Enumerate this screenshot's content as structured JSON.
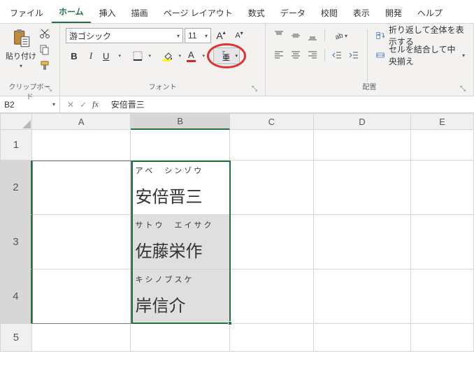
{
  "tabs": [
    "ファイル",
    "ホーム",
    "挿入",
    "描画",
    "ページ レイアウト",
    "数式",
    "データ",
    "校閲",
    "表示",
    "開発",
    "ヘルプ"
  ],
  "active_tab": "ホーム",
  "clipboard": {
    "paste_label": "貼り付け",
    "group_label": "クリップボード"
  },
  "font": {
    "name": "游ゴシック",
    "size": "11",
    "grow": "A",
    "shrink": "A",
    "bold": "B",
    "italic": "I",
    "underline": "U",
    "font_color_letter": "A",
    "group_label": "フォント"
  },
  "alignment": {
    "wrap_label": "折り返して全体を表示する",
    "merge_label": "セルを結合して中央揃え",
    "group_label": "配置"
  },
  "namebox": "B2",
  "formula": "安倍晋三",
  "columns": [
    "A",
    "B",
    "C",
    "D",
    "E"
  ],
  "rows": [
    "1",
    "2",
    "3",
    "4",
    "5"
  ],
  "cells": {
    "B2": {
      "ruby": "アベ　シンゾウ",
      "text": "安倍晋三"
    },
    "B3": {
      "ruby": "サトウ　エイサク",
      "text": "佐藤栄作"
    },
    "B4": {
      "ruby": "キシノブスケ",
      "text": "岸信介"
    }
  }
}
